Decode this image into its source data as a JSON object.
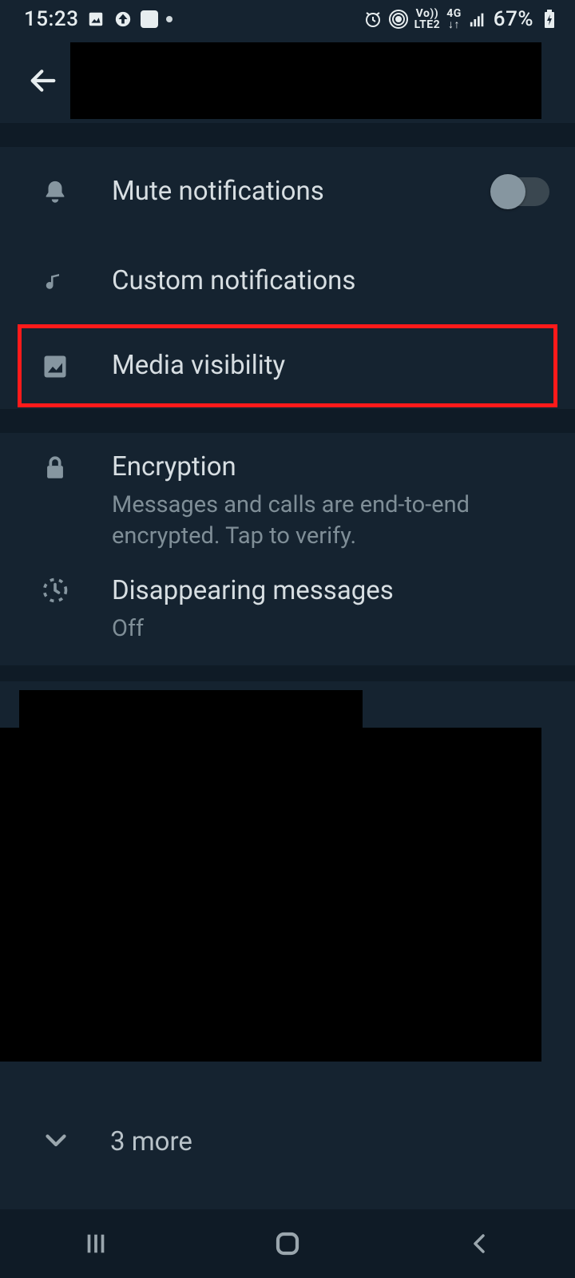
{
  "status": {
    "time": "15:23",
    "battery": "67%",
    "network_label": "LTE2",
    "vo_label": "Vo))",
    "data_label": "4G"
  },
  "settings": {
    "mute": {
      "label": "Mute notifications",
      "enabled": false
    },
    "custom": {
      "label": "Custom notifications"
    },
    "media": {
      "label": "Media visibility"
    },
    "encryption": {
      "label": "Encryption",
      "sub": "Messages and calls are end-to-end encrypted. Tap to verify."
    },
    "disappearing": {
      "label": "Disappearing messages",
      "value": "Off"
    }
  },
  "more": {
    "label": "3 more"
  }
}
